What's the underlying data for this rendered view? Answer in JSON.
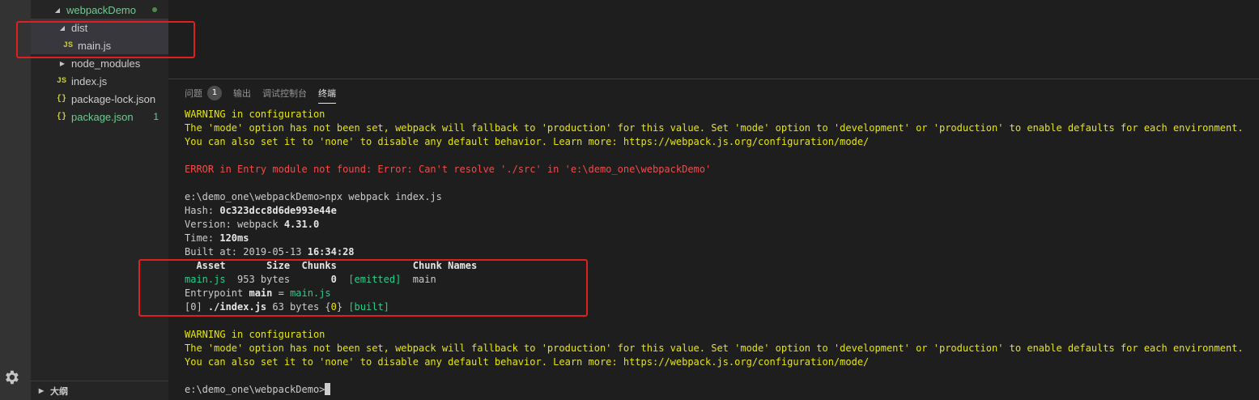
{
  "explorer": {
    "items": [
      {
        "label": "webpackDemo",
        "kind": "folder-open",
        "color": "#73c991"
      },
      {
        "label": "dist",
        "kind": "folder-open"
      },
      {
        "label": "main.js",
        "kind": "js",
        "icon_text": "JS"
      },
      {
        "label": "node_modules",
        "kind": "folder-closed"
      },
      {
        "label": "index.js",
        "kind": "js",
        "icon_text": "JS"
      },
      {
        "label": "package-lock.json",
        "kind": "json",
        "icon_text": "{}"
      },
      {
        "label": "package.json",
        "kind": "json",
        "icon_text": "{}",
        "badge": "1",
        "color": "#73c991"
      }
    ],
    "outline_label": "大纲"
  },
  "panel": {
    "tabs": [
      {
        "label": "问题",
        "badge": "1"
      },
      {
        "label": "输出"
      },
      {
        "label": "调试控制台"
      },
      {
        "label": "终端",
        "active": true
      }
    ]
  },
  "terminal": {
    "warn1_title": "WARNING in configuration",
    "warn1_line1": "The 'mode' option has not been set, webpack will fallback to 'production' for this value. Set 'mode' option to 'development' or 'production' to enable defaults for each environment.",
    "warn1_line2": "You can also set it to 'none' to disable any default behavior. Learn more: https://webpack.js.org/configuration/mode/",
    "error_line": "ERROR in Entry module not found: Error: Can't resolve './src' in 'e:\\demo_one\\webpackDemo'",
    "command": "e:\\demo_one\\webpackDemo>npx webpack index.js",
    "hash_label": "Hash: ",
    "hash_value": "0c323dcc8d6de993e44e",
    "version_label": "Version: webpack ",
    "version_value": "4.31.0",
    "time_label": "Time: ",
    "time_value": "120ms",
    "built_label": "Built at: 2019-05-13 ",
    "built_value": "16:34:28",
    "table_header": "  Asset       Size  Chunks             Chunk Names",
    "row_asset": "main.js",
    "row_size": "  953 bytes       ",
    "row_chunk": "0",
    "row_emitted": "  [emitted]",
    "row_name": "  main",
    "entry_label": "Entrypoint ",
    "entry_main": "main",
    "entry_eq": " = ",
    "entry_file": "main.js",
    "module_idx": "[0] ",
    "module_path": "./index.js",
    "module_size": " 63 bytes {",
    "module_chunk": "0",
    "module_close": "} ",
    "module_built": "[built]",
    "warn2_title": "WARNING in configuration",
    "warn2_line1": "The 'mode' option has not been set, webpack will fallback to 'production' for this value. Set 'mode' option to 'development' or 'production' to enable defaults for each environment.",
    "warn2_line2": "You can also set it to 'none' to disable any default behavior. Learn more: https://webpack.js.org/configuration/mode/",
    "prompt": "e:\\demo_one\\webpackDemo>"
  }
}
